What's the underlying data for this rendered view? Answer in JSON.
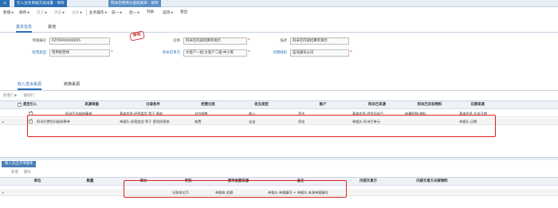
{
  "tabs": {
    "home_icon": "home-icon",
    "items": [
      {
        "label": "引入业务单据方案设置 - 修改",
        "active": true
      },
      {
        "label": "阿米巴费用分配结果单 - 修改",
        "active": false
      }
    ]
  },
  "toolbar": {
    "new": "新增",
    "save": "保存",
    "submit": "提交",
    "audit": "审核",
    "select": "选单",
    "biz_ops": "业务操作",
    "prev": "前一",
    "next": "后一",
    "list": "列表",
    "options": "选项",
    "exit": "退出"
  },
  "subtabs": {
    "basic": "基本信息",
    "other": "其他"
  },
  "form": {
    "doc_no_label": "单据编号",
    "doc_no": "PZYRFA0000005",
    "name_label": "名称",
    "name": "阿米巴内部结算单演示",
    "desc_label": "描述",
    "desc": "阿米巴内部结算单演示",
    "op_type_label": "经营类型",
    "op_type": "营用经营体",
    "unit_label": "阿米巴单元",
    "unit": "大客户一组;大客户二组;中小客",
    "org_label": "创建组织",
    "org": "蓝海通讯公司",
    "stamp": "审核"
  },
  "section": {
    "tab1": "收入支出来源",
    "tab2": "转换来源"
  },
  "grid1": {
    "tools": {
      "add_row": "新增行",
      "delete_row": "删除行"
    },
    "headers": {
      "enable": "是否引入",
      "source_doc": "来源单据",
      "filter": "分录条件",
      "category": "经营分类",
      "income_type": "收支类型",
      "account": "账户",
      "amoeba_src": "阿米巴来源",
      "amoeba_tgt": "阿米巴目标物料",
      "date_field": "日期来源"
    },
    "rows": [
      {
        "checked": true,
        "source_doc": "阿米巴内部结算单",
        "filter": "基本信息.经营类型 等于 服务",
        "category": "对内销售",
        "income_type": "收入",
        "account": "资金",
        "amoeba_src": "基本信息.供货阿米巴",
        "amoeba_tgt": "结算明细.物料",
        "date_field": "基本信息.业务日期"
      },
      {
        "checked": true,
        "source_doc": "阿米巴费用分配结果单",
        "filter": "单据头.经营类型 等于 营用经营体",
        "category": "电费",
        "income_type": "支出",
        "account": "资金",
        "amoeba_src": "单据头.阿米巴单元",
        "amoeba_tgt": "",
        "date_field": "单据头.日期"
      }
    ]
  },
  "grid2": {
    "title": "收入支出子单据体",
    "tools": {
      "add": "新增",
      "delete": "删除"
    },
    "headers": {
      "unit": "单位",
      "qty": "数量",
      "price": "单价",
      "currency": "币别",
      "amount_src": "原币金额来源",
      "note": "备注",
      "internal_key": "内部交易方",
      "internal_type": "内部交易方关联物料"
    },
    "rows": [
      {
        "unit": "",
        "qty": "",
        "price": "",
        "currency": "记账本位币",
        "amount_src": "单据体.金额",
        "note": "单据头.单据编号 + 单据头.来源单据编号",
        "internal_key": "",
        "internal_type": ""
      }
    ]
  }
}
